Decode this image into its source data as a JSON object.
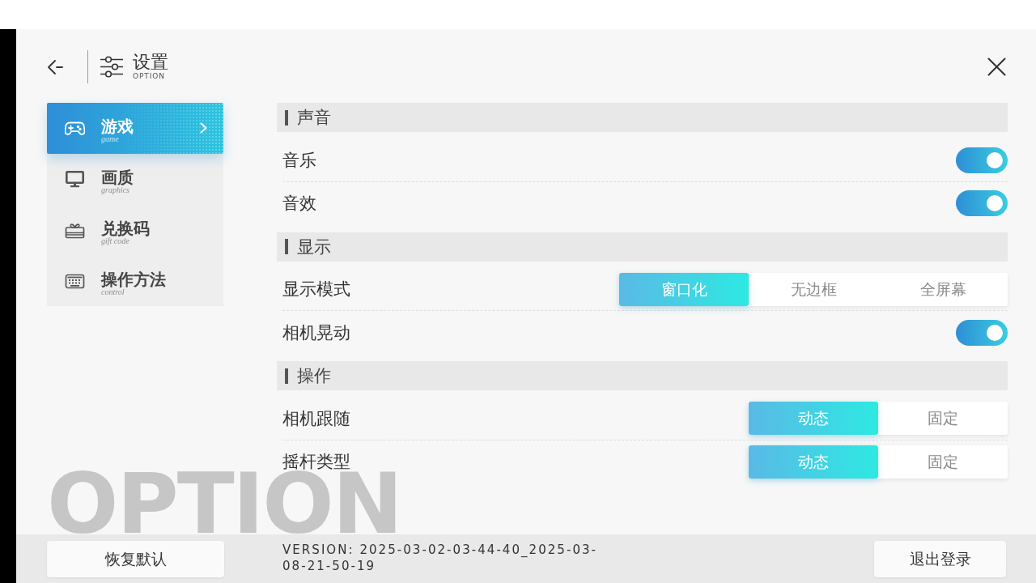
{
  "header": {
    "title": "设置",
    "subtitle": "OPTION"
  },
  "sidebar": {
    "items": [
      {
        "kind": "game",
        "label": "游戏",
        "sublabel": "game",
        "selected": true
      },
      {
        "kind": "graphics",
        "label": "画质",
        "sublabel": "graphics",
        "selected": false
      },
      {
        "kind": "code",
        "label": "兑换码",
        "sublabel": "gift code",
        "selected": false
      },
      {
        "kind": "control",
        "label": "操作方法",
        "sublabel": "control",
        "selected": false
      }
    ]
  },
  "sections": [
    {
      "title": "声音",
      "rows": [
        {
          "kind": "toggle",
          "label": "音乐",
          "on": true
        },
        {
          "kind": "toggle",
          "label": "音效",
          "on": true
        }
      ]
    },
    {
      "title": "显示",
      "rows": [
        {
          "kind": "choice",
          "label": "显示模式",
          "options": [
            {
              "label": "窗口化",
              "selected": true
            },
            {
              "label": "无边框",
              "selected": false
            },
            {
              "label": "全屏幕",
              "selected": false
            }
          ]
        },
        {
          "kind": "toggle",
          "label": "相机晃动",
          "on": true
        }
      ]
    },
    {
      "title": "操作",
      "rows": [
        {
          "kind": "choice",
          "label": "相机跟随",
          "options": [
            {
              "label": "动态",
              "selected": true
            },
            {
              "label": "固定",
              "selected": false
            }
          ]
        },
        {
          "kind": "choice",
          "label": "摇杆类型",
          "options": [
            {
              "label": "动态",
              "selected": true
            },
            {
              "label": "固定",
              "selected": false
            }
          ]
        }
      ]
    }
  ],
  "background_text": "OPTION",
  "footer": {
    "reset_button": "恢复默认",
    "version": "VERSION: 2025-03-02-03-44-40_2025-03-08-21-50-19",
    "logout_button": "退出登录"
  }
}
